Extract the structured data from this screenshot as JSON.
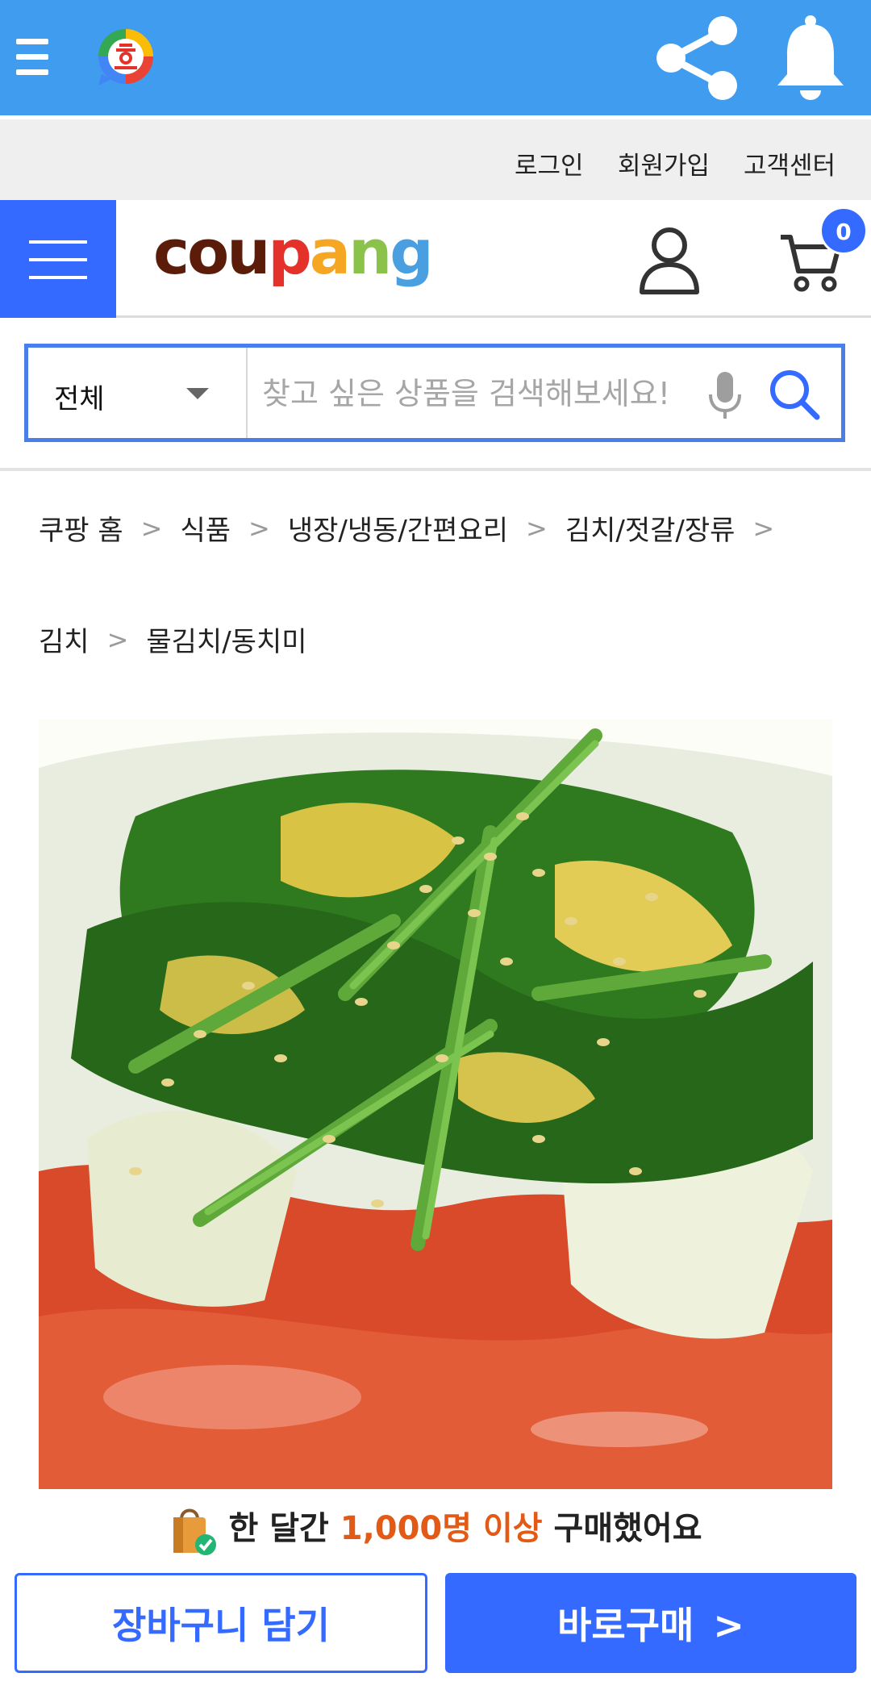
{
  "top_links": {
    "login": "로그인",
    "signup": "회원가입",
    "customer_center": "고객센터"
  },
  "brand": {
    "letters": [
      "cou",
      "p",
      "a",
      "n",
      "g"
    ]
  },
  "cart": {
    "count": "0"
  },
  "search": {
    "scope": "전체",
    "placeholder": "찾고 싶은 상품을 검색해보세요!"
  },
  "breadcrumb": {
    "items": [
      "쿠팡 홈",
      "식품",
      "냉장/냉동/간편요리",
      "김치/젓갈/장류",
      "김치",
      "물김치/동치미"
    ]
  },
  "social_proof": {
    "prefix": "한 달간",
    "highlight": "1,000명 이상",
    "suffix": "구매했어요"
  },
  "actions": {
    "add_to_cart": "장바구니 담기",
    "buy_now": "바로구매",
    "buy_now_chevron": ">"
  },
  "colors": {
    "appbar": "#3f9cef",
    "primary": "#346aff",
    "highlight": "#e25a15"
  }
}
